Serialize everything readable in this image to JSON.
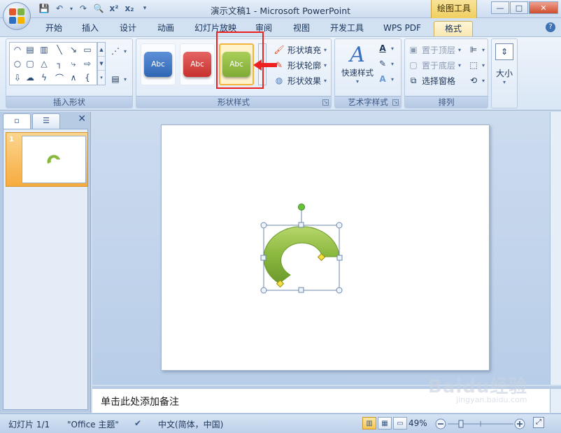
{
  "window": {
    "title": "演示文稿1 - Microsoft PowerPoint",
    "context_tab": "绘图工具",
    "controls": {
      "minimize": "—",
      "maximize": "□",
      "close": "✕"
    }
  },
  "quick_access": {
    "icons": [
      "save-icon",
      "undo-icon",
      "redo-icon",
      "print-preview-icon",
      "superscript-icon",
      "subscript-icon"
    ]
  },
  "tabs": [
    {
      "label": "开始"
    },
    {
      "label": "插入"
    },
    {
      "label": "设计"
    },
    {
      "label": "动画"
    },
    {
      "label": "幻灯片放映"
    },
    {
      "label": "审阅"
    },
    {
      "label": "视图"
    },
    {
      "label": "开发工具"
    },
    {
      "label": "WPS PDF"
    },
    {
      "label": "格式",
      "active": true
    }
  ],
  "ribbon": {
    "insert_shapes": {
      "label": "插入形状"
    },
    "shape_styles": {
      "label": "形状样式",
      "gallery": [
        {
          "text": "Abc",
          "color": "#2f66b4"
        },
        {
          "text": "Abc",
          "color": "#c7302e"
        },
        {
          "text": "Abc",
          "color": "#7fab36",
          "selected": true
        }
      ],
      "fill": "形状填充",
      "outline": "形状轮廓",
      "effects": "形状效果"
    },
    "wordart": {
      "label": "艺术字样式",
      "quick_styles": "快速样式"
    },
    "arrange": {
      "label": "排列",
      "bring_front": "置于顶层",
      "send_back": "置于底层",
      "selection_pane": "选择窗格"
    },
    "size": {
      "label": "大小"
    }
  },
  "slides_panel": {
    "slide_number": "1"
  },
  "notes": {
    "placeholder": "单击此处添加备注"
  },
  "status": {
    "slide": "幻灯片 1/1",
    "theme": "\"Office 主题\"",
    "language": "中文(简体，中国)",
    "zoom": "49%"
  },
  "colors": {
    "shape_green": "#8ab83f",
    "shape_green_dark": "#6c9a2c",
    "highlight_red": "#ee2020",
    "handle_green": "#67c23a"
  },
  "watermark": {
    "text": "Baidu经验",
    "subtext": "jingyan.baidu.com"
  }
}
